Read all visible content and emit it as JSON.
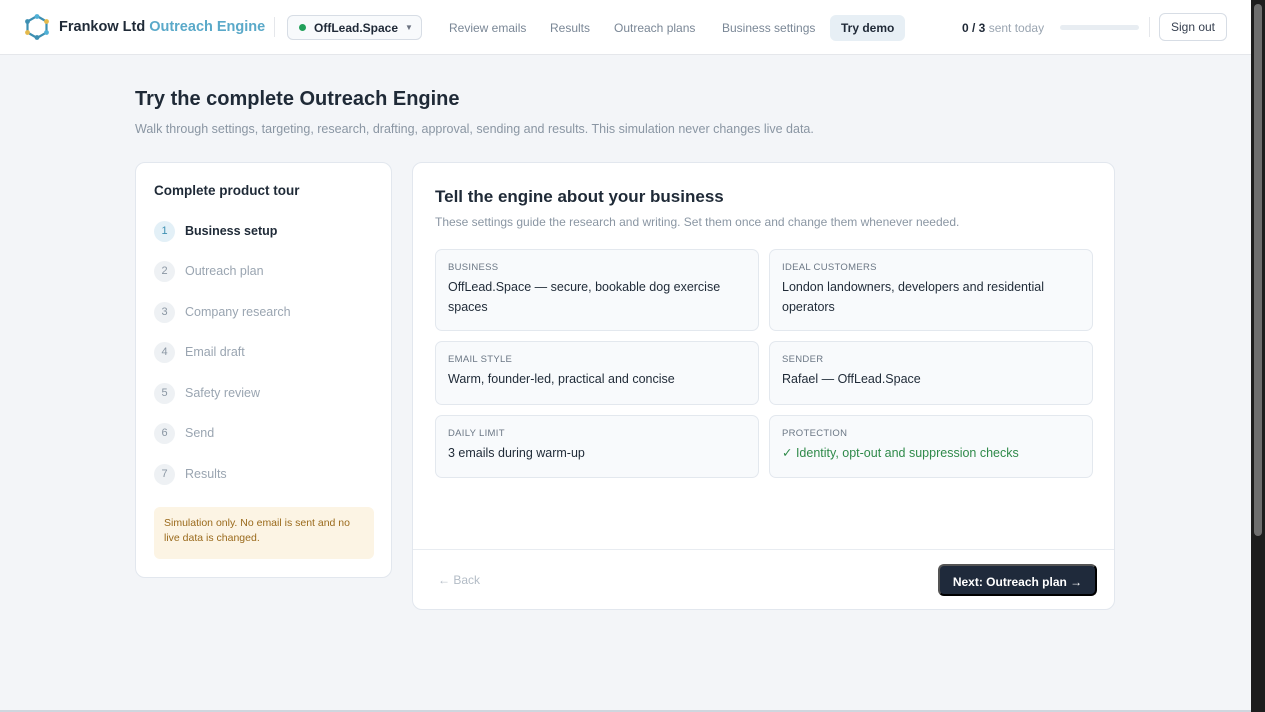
{
  "header": {
    "brand_name": "Frankow Ltd",
    "brand_product": "Outreach Engine",
    "workspace": "OffLead.Space",
    "nav": [
      "Review emails",
      "Results",
      "Outreach plans",
      "Business settings",
      "Try demo"
    ],
    "active_nav": "Try demo",
    "sent_count": "0 / 3",
    "sent_suffix": "sent today",
    "sent_fraction": 0,
    "sign_out": "Sign out"
  },
  "page": {
    "title": "Try the complete Outreach Engine",
    "subtitle": "Walk through settings, targeting, research, drafting, approval, sending and results. This simulation never changes live data."
  },
  "tour": {
    "title": "Complete product tour",
    "steps": [
      {
        "num": "1",
        "label": "Business setup"
      },
      {
        "num": "2",
        "label": "Outreach plan"
      },
      {
        "num": "3",
        "label": "Company research"
      },
      {
        "num": "4",
        "label": "Email draft"
      },
      {
        "num": "5",
        "label": "Safety review"
      },
      {
        "num": "6",
        "label": "Send"
      },
      {
        "num": "7",
        "label": "Results"
      }
    ],
    "current_step": 1,
    "notice": "Simulation only. No email is sent and no live data is changed."
  },
  "main": {
    "title": "Tell the engine about your business",
    "subtitle": "These settings guide the research and writing. Set them once and change them whenever needed.",
    "fields": [
      {
        "label": "Business",
        "value": "OffLead.Space — secure, bookable dog exercise spaces"
      },
      {
        "label": "Ideal customers",
        "value": "London landowners, developers and residential operators"
      },
      {
        "label": "Email style",
        "value": "Warm, founder-led, practical and concise"
      },
      {
        "label": "Sender",
        "value": "Rafael — OffLead.Space"
      },
      {
        "label": "Daily limit",
        "value": "3 emails during warm-up"
      },
      {
        "label": "Protection",
        "value": "✓ Identity, opt-out and suppression checks"
      }
    ],
    "back_label": "← Back",
    "next_label": "Next: Outreach plan →"
  },
  "colors": {
    "accent": "#5aa9c9",
    "primary_button": "#1f2a3b",
    "success": "#2f8a4a",
    "notice_bg": "#fcf4e4"
  },
  "icons": {
    "brand": "network-logo-icon",
    "workspace_status": "status-dot-icon",
    "workspace_caret": "chevron-down-icon"
  }
}
